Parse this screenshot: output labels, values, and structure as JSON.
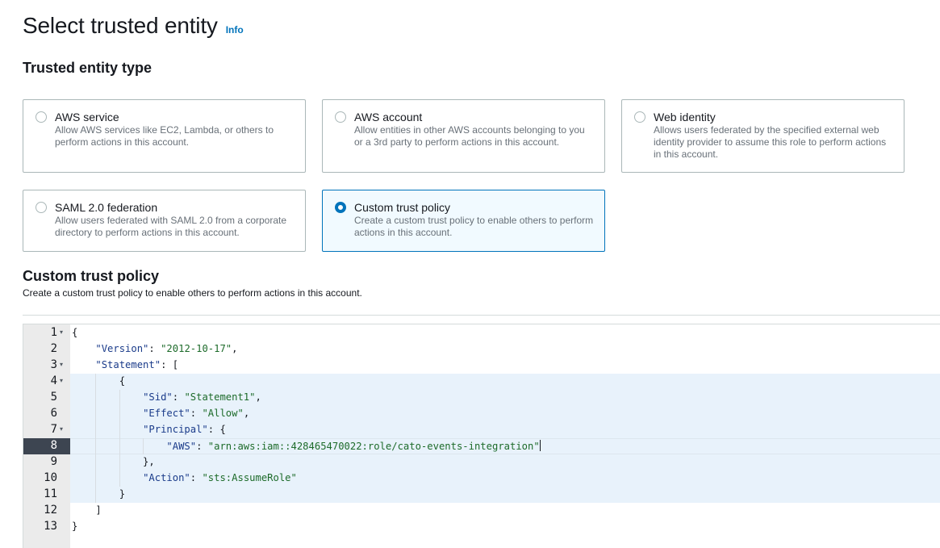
{
  "page": {
    "title": "Select trusted entity",
    "info_link": "Info"
  },
  "entity_type": {
    "heading": "Trusted entity type",
    "options": [
      {
        "title": "AWS service",
        "desc": "Allow AWS services like EC2, Lambda, or others to perform actions in this account.",
        "selected": false
      },
      {
        "title": "AWS account",
        "desc": "Allow entities in other AWS accounts belonging to you or a 3rd party to perform actions in this account.",
        "selected": false
      },
      {
        "title": "Web identity",
        "desc": "Allows users federated by the specified external web identity provider to assume this role to perform actions in this account.",
        "selected": false
      },
      {
        "title": "SAML 2.0 federation",
        "desc": "Allow users federated with SAML 2.0 from a corporate directory to perform actions in this account.",
        "selected": false
      },
      {
        "title": "Custom trust policy",
        "desc": "Create a custom trust policy to enable others to perform actions in this account.",
        "selected": true
      }
    ]
  },
  "policy_section": {
    "heading": "Custom trust policy",
    "description": "Create a custom trust policy to enable others to perform actions in this account."
  },
  "editor": {
    "active_line": 8,
    "lines": [
      {
        "n": "1",
        "text": "{"
      },
      {
        "n": "2",
        "text": "    \"Version\": \"2012-10-17\","
      },
      {
        "n": "3",
        "text": "    \"Statement\": ["
      },
      {
        "n": "4",
        "text": "        {"
      },
      {
        "n": "5",
        "text": "            \"Sid\": \"Statement1\","
      },
      {
        "n": "6",
        "text": "            \"Effect\": \"Allow\","
      },
      {
        "n": "7",
        "text": "            \"Principal\": {"
      },
      {
        "n": "8",
        "text": "                \"AWS\": \"arn:aws:iam::428465470022:role/cato-events-integration\""
      },
      {
        "n": "9",
        "text": "            },"
      },
      {
        "n": "10",
        "text": "            \"Action\": \"sts:AssumeRole\""
      },
      {
        "n": "11",
        "text": "        }"
      },
      {
        "n": "12",
        "text": "    ]"
      },
      {
        "n": "13",
        "text": "}"
      }
    ]
  }
}
